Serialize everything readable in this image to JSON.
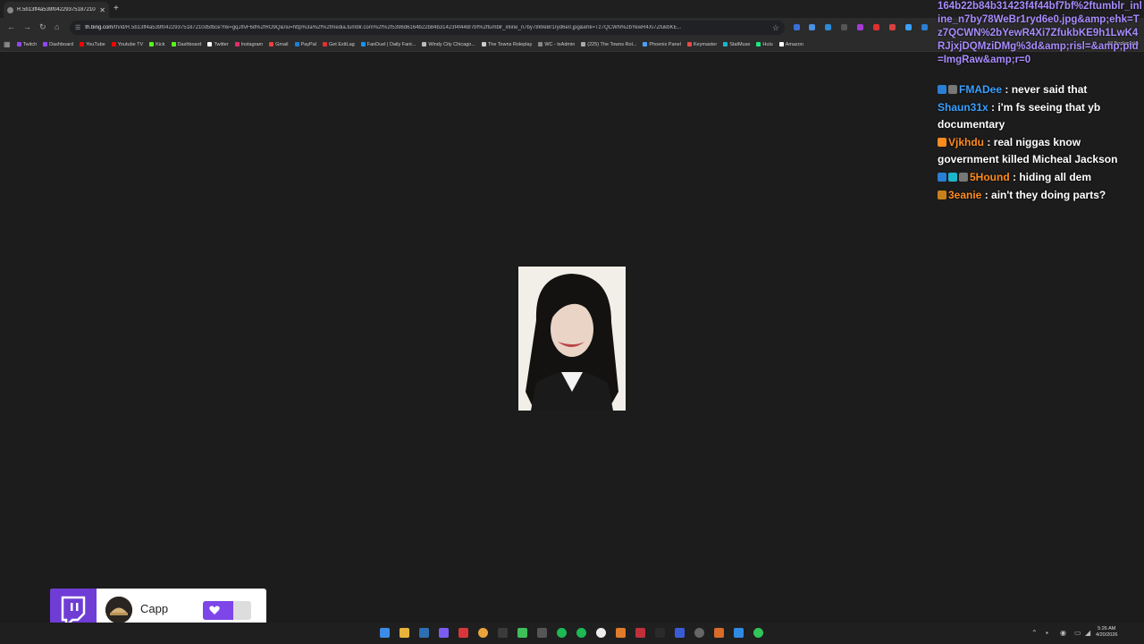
{
  "browser": {
    "tab_title": "R.5b13ff4a539f04229375187210d5...",
    "url_host": "th.bing.com",
    "url_rest": "/th/id/R.5b13ff4a539f04229375187210d5fbce?rik=gqJIfvF6d%2fRO9Q&riu=http%3a%2f%2fmedia.tumblr.com%2f%2f5398d6164b22b84b31423f4f44bf7bf%2ftumblr_inline_n7by78WeBr1ryd6e0.jpg&ehk=Tz7QCWN%2bYewR4Xi7ZfukbKE...",
    "all_bookmarks": "All Bookmarks",
    "bookmarks": [
      {
        "label": "Twitch",
        "color": "#9146ff"
      },
      {
        "label": "Dashboard",
        "color": "#9146ff"
      },
      {
        "label": "YouTube",
        "color": "#ff0000"
      },
      {
        "label": "Youtube TV",
        "color": "#ff0000"
      },
      {
        "label": "Kick",
        "color": "#53fc18"
      },
      {
        "label": "Dashboard",
        "color": "#53fc18"
      },
      {
        "label": "Twitter",
        "color": "#ffffff"
      },
      {
        "label": "Instagram",
        "color": "#e1306c"
      },
      {
        "label": "Gmail",
        "color": "#ea4335"
      },
      {
        "label": "PayPal",
        "color": "#1a7fd6"
      },
      {
        "label": "Get ExitLag",
        "color": "#e03030"
      },
      {
        "label": "FanDuel | Daily Fant...",
        "color": "#1493ff"
      },
      {
        "label": "Windy City Chicago...",
        "color": "#bbbbbb"
      },
      {
        "label": "The Towns Roleplay",
        "color": "#cccccc"
      },
      {
        "label": "WC - txAdmin",
        "color": "#888888"
      },
      {
        "label": "(225) The Towns Rol...",
        "color": "#aaaaaa"
      },
      {
        "label": "Phoenix Panel",
        "color": "#4aa3ff"
      },
      {
        "label": "Keymaster",
        "color": "#e84a4a"
      },
      {
        "label": "StatMuse",
        "color": "#1bb6c9"
      },
      {
        "label": "Hulu",
        "color": "#1ce783"
      },
      {
        "label": "Amazon",
        "color": "#ffffff"
      }
    ]
  },
  "chat": {
    "url_tail": "164b22b84b31423f4f44bf7bf%2ftumblr_inline_n7by78WeBr1ryd6e0.jpg&amp;ehk=Tz7QCWN%2bYewR4Xi7ZfukbKE9h1LwK4RJjxjDQMziDMg%3d&amp;risl=&amp;pid=ImgRaw&amp;r=0",
    "messages": [
      {
        "user": "FMADee",
        "text": "never said that",
        "user_color": "#3aa0ff"
      },
      {
        "user": "Shaun31x",
        "text": "i'm fs seeing that yb documentary",
        "user_color": "#3aa0ff"
      },
      {
        "user": "Vjkhdu",
        "text": "real niggas know government killed Micheal Jackson",
        "user_color": "#ff8a1f"
      },
      {
        "user": "5Hound",
        "text": "hiding all dem",
        "user_color": "#ff8a1f"
      },
      {
        "user": "3eanie",
        "text": "ain't they doing parts?",
        "user_color": "#ff8a1f"
      }
    ]
  },
  "follow_alert": {
    "name": "Capp"
  },
  "colors": {
    "accent": "#7e45e8",
    "twitch_purple": "#6f3cd6"
  }
}
